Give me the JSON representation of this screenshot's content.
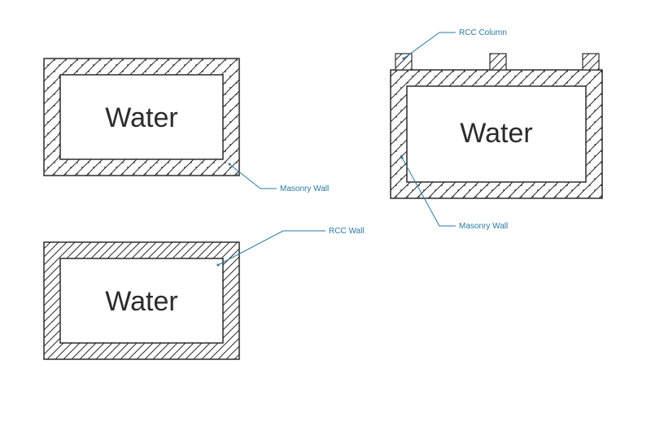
{
  "tanks": {
    "top_left": {
      "label": "Water"
    },
    "bottom_left": {
      "label": "Water"
    },
    "right": {
      "label": "Water"
    }
  },
  "callouts": {
    "masonry_wall_left": "Masonry Wall",
    "rcc_wall": "RCC Wall",
    "masonry_wall_right": "Masonry Wall",
    "rcc_column": "RCC Column"
  }
}
